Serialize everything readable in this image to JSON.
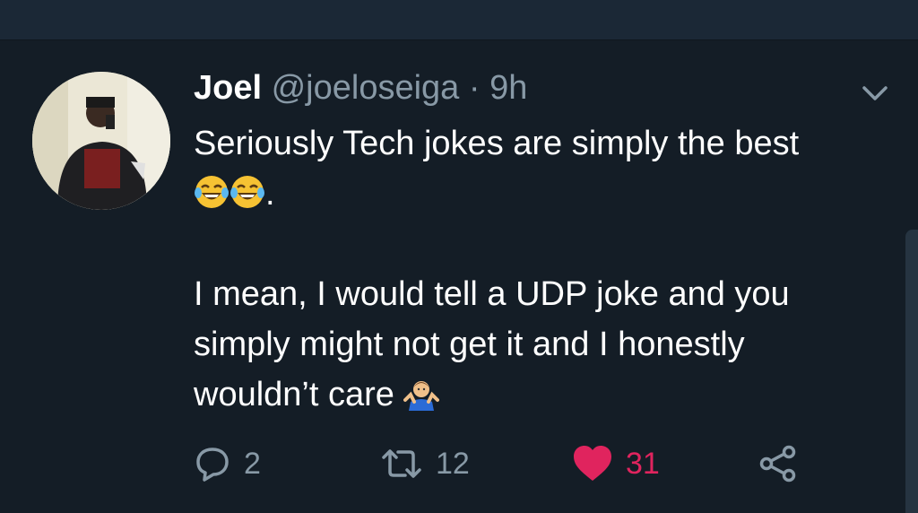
{
  "tweet": {
    "author_name": "Joel",
    "handle": "@joeloseiga",
    "separator": "·",
    "time": "9h",
    "line1": "Seriously Tech jokes are simply the best",
    "line2_suffix": ".",
    "line3": "I mean, I would tell a UDP joke and you",
    "line4": "simply might not get it and I honestly",
    "line5": "wouldn’t care",
    "emojis": [
      "face-with-tears-of-joy-emoji",
      "face-with-tears-of-joy-emoji",
      "person-shrugging-emoji"
    ]
  },
  "actions": {
    "reply_count": "2",
    "retweet_count": "12",
    "like_count": "31"
  },
  "colors": {
    "background": "#141d26",
    "muted": "#8899a6",
    "like": "#e0245e"
  },
  "icons": [
    "chevron-down-icon",
    "reply-icon",
    "retweet-icon",
    "heart-icon",
    "share-icon"
  ]
}
